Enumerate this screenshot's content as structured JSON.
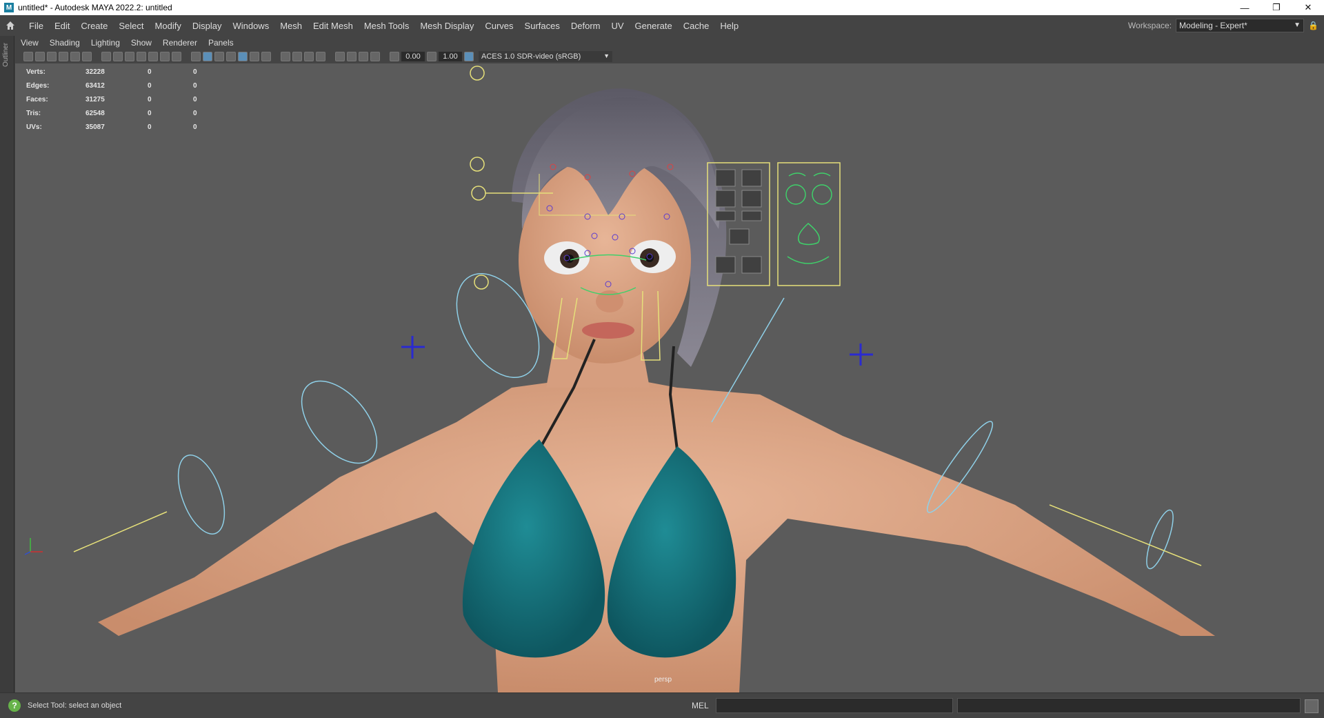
{
  "window": {
    "title": "untitled* - Autodesk MAYA 2022.2: untitled",
    "icon": "maya-app-icon",
    "controls": [
      "minimize",
      "restore",
      "close"
    ]
  },
  "menubar": {
    "items": [
      "File",
      "Edit",
      "Create",
      "Select",
      "Modify",
      "Display",
      "Windows",
      "Mesh",
      "Edit Mesh",
      "Mesh Tools",
      "Mesh Display",
      "Curves",
      "Surfaces",
      "Deform",
      "UV",
      "Generate",
      "Cache",
      "Help"
    ],
    "workspace_label": "Workspace:",
    "workspace_value": "Modeling - Expert*"
  },
  "left_strip": {
    "label": "Outliner"
  },
  "panel_menu": {
    "items": [
      "View",
      "Shading",
      "Lighting",
      "Show",
      "Renderer",
      "Panels"
    ]
  },
  "panel_toolbar": {
    "exposure": "0.00",
    "gamma": "1.00",
    "color_space": "ACES 1.0 SDR-video (sRGB)"
  },
  "hud": {
    "rows": [
      {
        "label": "Verts:",
        "v1": "32228",
        "v2": "0",
        "v3": "0"
      },
      {
        "label": "Edges:",
        "v1": "63412",
        "v2": "0",
        "v3": "0"
      },
      {
        "label": "Faces:",
        "v1": "31275",
        "v2": "0",
        "v3": "0"
      },
      {
        "label": "Tris:",
        "v1": "62548",
        "v2": "0",
        "v3": "0"
      },
      {
        "label": "UVs:",
        "v1": "35087",
        "v2": "0",
        "v3": "0"
      }
    ]
  },
  "viewport": {
    "camera_label": "persp"
  },
  "statusbar": {
    "help_message": "Select Tool: select an object",
    "mel_label": "MEL"
  },
  "colors": {
    "viewport_bg": "#5b5b5b",
    "skin": "#d9a07e",
    "bikini": "#17707a",
    "rig_yellow": "#e6e07a",
    "rig_blue": "#8fd0e8"
  }
}
